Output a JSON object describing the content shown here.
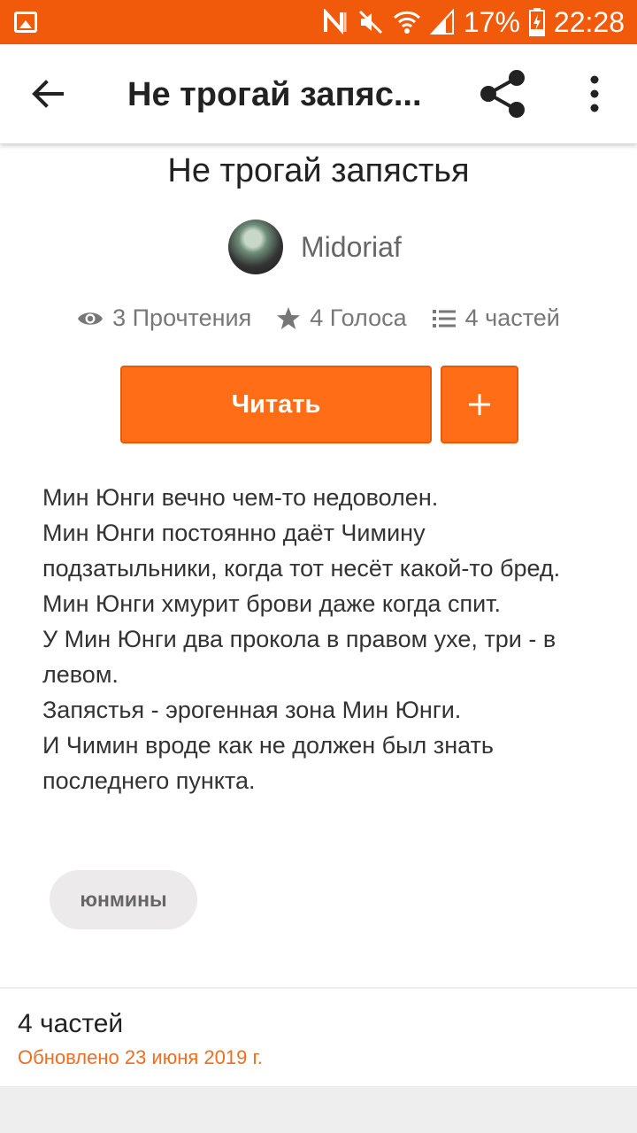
{
  "status_bar": {
    "battery": "17%",
    "time": "22:28"
  },
  "app_bar": {
    "title": "Не трогай запяс..."
  },
  "story": {
    "title": "Не трогай запястья",
    "author": "Midoriaf",
    "stats": {
      "reads": "3 Прочтения",
      "votes": "4 Голоса",
      "parts": "4 частей"
    },
    "read_button": "Читать",
    "description": [
      "Мин Юнги вечно чем-то недоволен.",
      "Мин Юнги постоянно даёт Чимину подзатыльники, когда тот несёт какой-то бред.",
      "Мин Юнги хмурит брови даже когда спит.",
      "У Мин Юнги два прокола в правом ухе, три - в левом.",
      "Запястья - эрогенная зона Мин Юнги.",
      "И Чимин вроде как не должен был знать последнего пункта."
    ],
    "tag": "юнмины"
  },
  "parts_section": {
    "title": "4 частей",
    "updated": "Обновлено 23 июня 2019 г."
  },
  "colors": {
    "accent": "#ff6d17",
    "status_bar": "#f15a0a"
  },
  "icons": {
    "back": "arrow-back-icon",
    "share": "share-icon",
    "more": "more-vert-icon",
    "reads": "eye-icon",
    "votes": "star-icon",
    "parts": "list-icon",
    "add": "plus-icon"
  }
}
